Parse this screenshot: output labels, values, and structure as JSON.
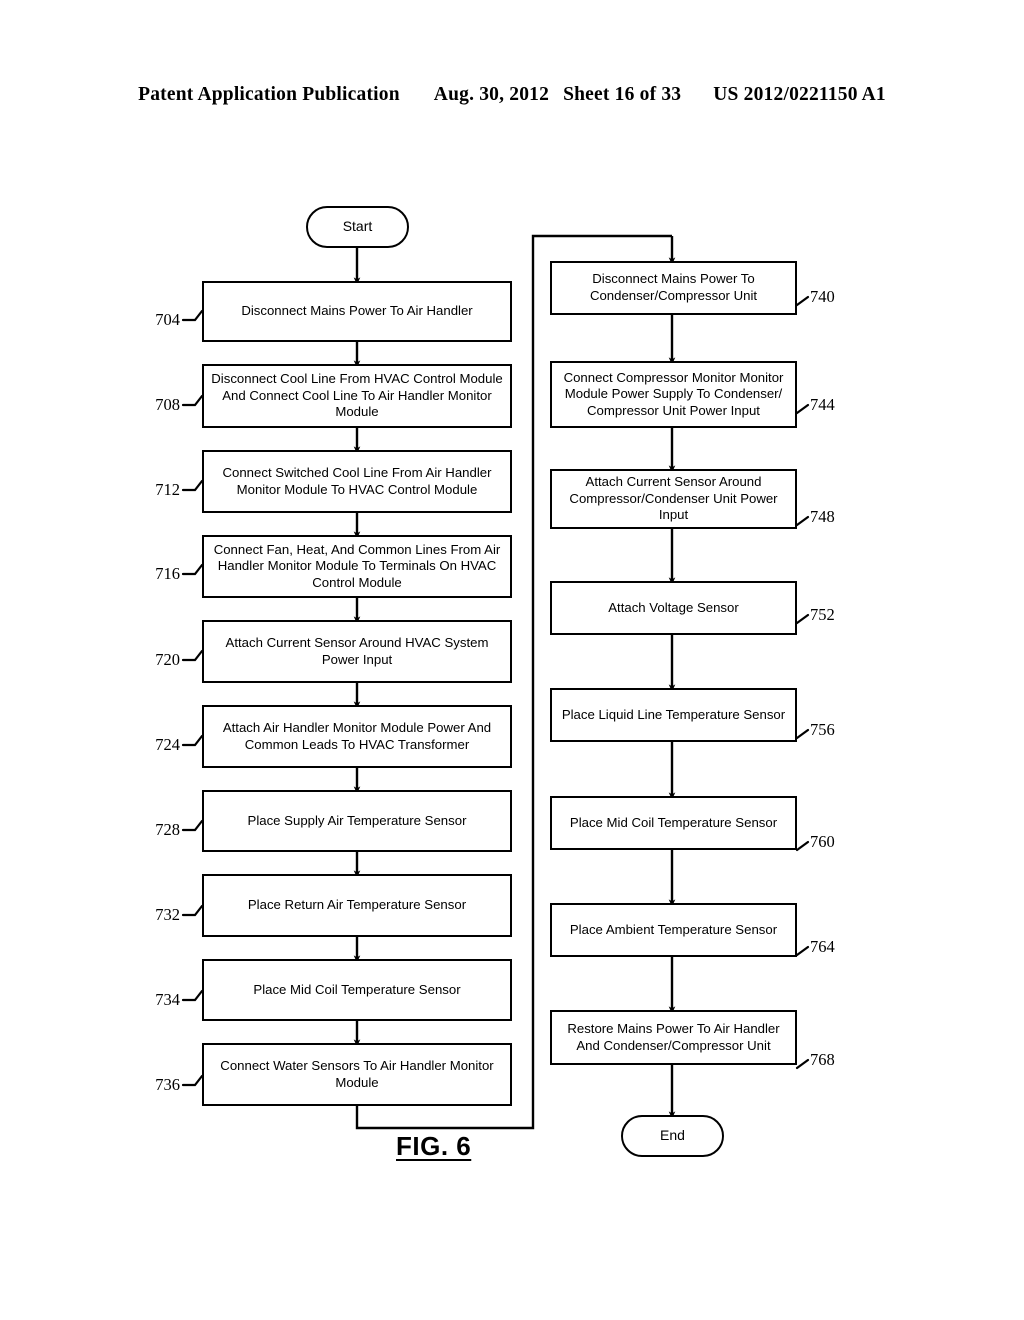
{
  "header": {
    "publication": "Patent Application Publication",
    "date": "Aug. 30, 2012",
    "sheet": "Sheet 16 of 33",
    "patent_number": "US 2012/0221150 A1"
  },
  "figure": {
    "caption": "FIG. 6",
    "start_label": "Start",
    "end_label": "End"
  },
  "flow": {
    "left_column": [
      {
        "ref": "704",
        "text": "Disconnect Mains Power To Air Handler"
      },
      {
        "ref": "708",
        "text": "Disconnect Cool Line From HVAC Control Module And Connect Cool Line To Air Handler Monitor Module"
      },
      {
        "ref": "712",
        "text": "Connect Switched Cool Line From Air Handler Monitor Module To HVAC Control Module"
      },
      {
        "ref": "716",
        "text": "Connect Fan, Heat, And Common Lines From Air Handler Monitor Module To Terminals On HVAC Control Module"
      },
      {
        "ref": "720",
        "text": "Attach Current Sensor Around HVAC System Power Input"
      },
      {
        "ref": "724",
        "text": "Attach Air Handler Monitor Module Power And Common Leads To HVAC Transformer"
      },
      {
        "ref": "728",
        "text": "Place Supply Air Temperature Sensor"
      },
      {
        "ref": "732",
        "text": "Place Return Air Temperature Sensor"
      },
      {
        "ref": "734",
        "text": "Place Mid Coil Temperature Sensor"
      },
      {
        "ref": "736",
        "text": "Connect Water Sensors To Air Handler Monitor Module"
      }
    ],
    "right_column": [
      {
        "ref": "740",
        "text": "Disconnect Mains Power To Condenser/Compressor Unit"
      },
      {
        "ref": "744",
        "text": "Connect Compressor Monitor Monitor Module Power Supply To Condenser/ Compressor Unit Power Input"
      },
      {
        "ref": "748",
        "text": "Attach Current Sensor Around Compressor/Condenser Unit Power Input"
      },
      {
        "ref": "752",
        "text": "Attach Voltage Sensor"
      },
      {
        "ref": "756",
        "text": "Place Liquid Line Temperature Sensor"
      },
      {
        "ref": "760",
        "text": "Place Mid Coil Temperature Sensor"
      },
      {
        "ref": "764",
        "text": "Place Ambient Temperature Sensor"
      },
      {
        "ref": "768",
        "text": "Restore Mains Power To Air Handler And Condenser/Compressor Unit"
      }
    ]
  },
  "colors": {
    "ink": "#000000",
    "paper": "#ffffff"
  }
}
